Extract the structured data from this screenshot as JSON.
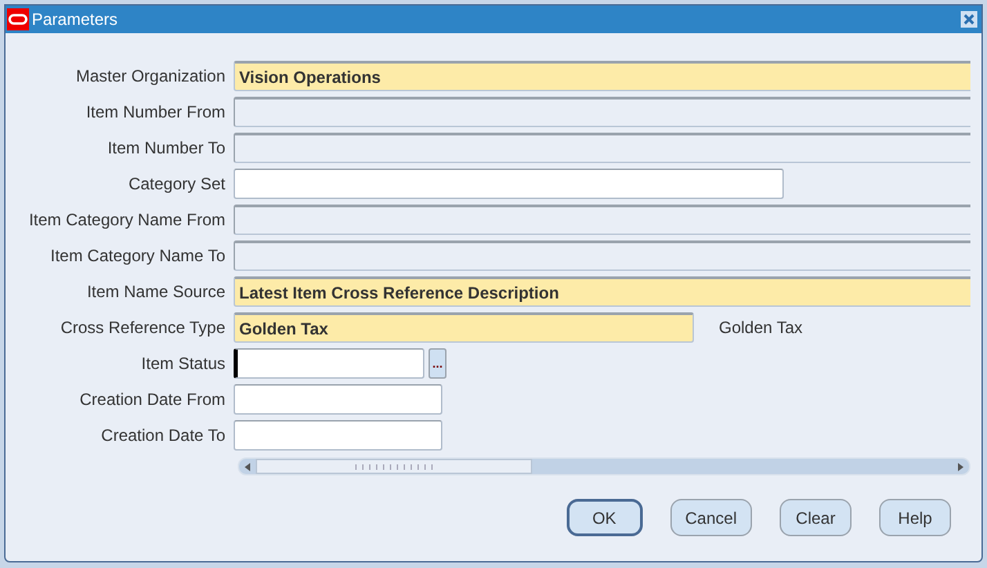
{
  "window": {
    "title": "Parameters"
  },
  "fields": [
    {
      "label": "Master Organization",
      "kind": "required",
      "value": "Vision Operations"
    },
    {
      "label": "Item Number From",
      "kind": "disabled"
    },
    {
      "label": "Item Number To",
      "kind": "disabled"
    },
    {
      "label": "Category Set",
      "kind": "enabled"
    },
    {
      "label": "Item Category Name From",
      "kind": "disabled"
    },
    {
      "label": "Item Category Name To",
      "kind": "disabled"
    },
    {
      "label": "Item Name Source",
      "kind": "required",
      "value": "Latest Item Cross Reference Description"
    },
    {
      "label": "Cross Reference Type",
      "kind": "required",
      "value": "Golden Tax",
      "description": "Golden Tax"
    },
    {
      "label": "Item Status",
      "kind": "enabled",
      "focused": true,
      "lov": "..."
    },
    {
      "label": "Creation Date From",
      "kind": "enabled"
    },
    {
      "label": "Creation Date To",
      "kind": "enabled"
    }
  ],
  "buttons": [
    {
      "label": "OK",
      "default": true
    },
    {
      "label": "Cancel",
      "default": false
    },
    {
      "label": "Clear",
      "default": false
    },
    {
      "label": "Help",
      "default": false
    }
  ]
}
